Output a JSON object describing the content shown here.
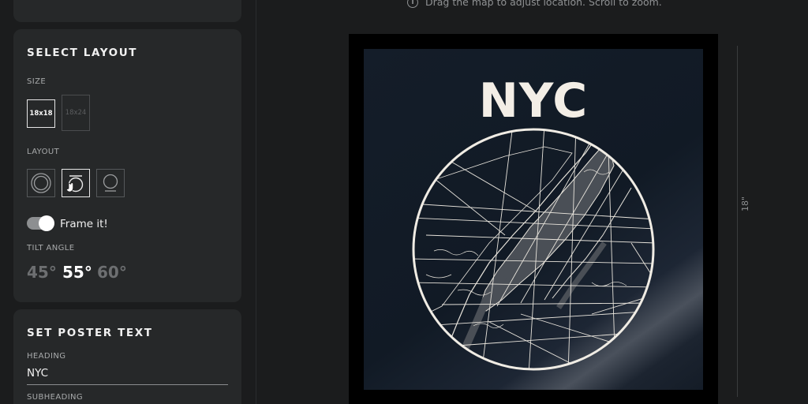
{
  "hint": {
    "icon": "info-icon",
    "text": "Drag the map to adjust location. Scroll to zoom."
  },
  "layout_panel": {
    "title": "SELECT LAYOUT",
    "size_label": "SIZE",
    "sizes": [
      {
        "label": "18x18",
        "selected": true
      },
      {
        "label": "18x24",
        "selected": false
      }
    ],
    "layout_label": "LAYOUT",
    "layouts": [
      {
        "icon": "circle-layout-icon",
        "selected": false
      },
      {
        "icon": "circle-with-title-layout-icon",
        "selected": true
      },
      {
        "icon": "circle-with-bottom-text-layout-icon",
        "selected": false
      }
    ],
    "frame_toggle": {
      "label": "Frame it!",
      "on": true
    },
    "tilt_label": "TILT ANGLE",
    "tilt_options": [
      {
        "label": "45°",
        "selected": false
      },
      {
        "label": "55°",
        "selected": true
      },
      {
        "label": "60°",
        "selected": false
      }
    ]
  },
  "text_panel": {
    "title": "SET POSTER TEXT",
    "heading_label": "HEADING",
    "heading_value": "NYC",
    "subheading_label": "SUBHEADING"
  },
  "poster": {
    "heading": "NYC",
    "framed": true,
    "dimension_label": "18\""
  },
  "colors": {
    "background": "#1b1c1d",
    "card": "#262829",
    "poster_bg": "#141d29",
    "poster_text": "#f3eee6",
    "map_lines": "#e8e4dc",
    "map_land": "#4a4f56"
  }
}
